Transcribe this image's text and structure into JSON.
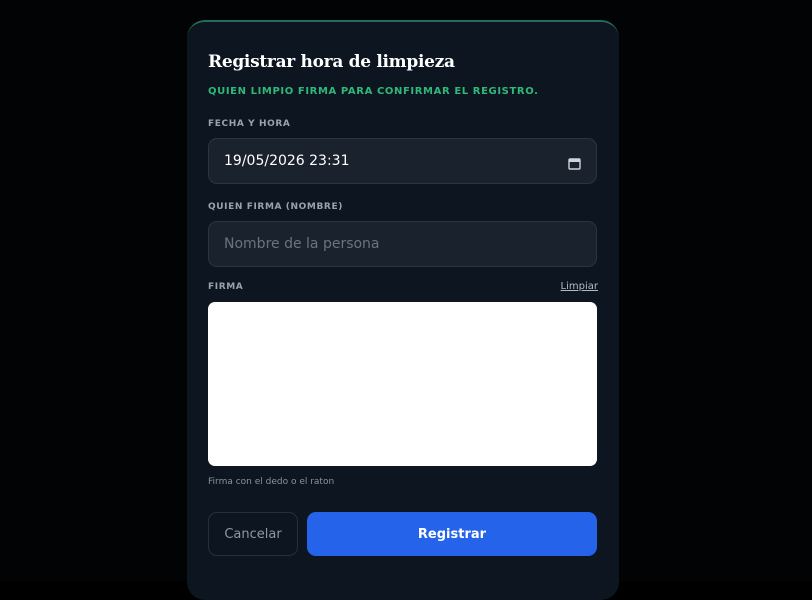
{
  "modal": {
    "title": "Registrar hora de limpieza",
    "subtitle": "QUIEN LIMPIO FIRMA PARA CONFIRMAR EL REGISTRO."
  },
  "datetime": {
    "label": "FECHA Y HORA",
    "value": "19/05/2026  23:31",
    "icon": "calendar-icon"
  },
  "signer": {
    "label": "QUIEN FIRMA (NOMBRE)",
    "placeholder": "Nombre de la persona",
    "value": ""
  },
  "signature": {
    "label": "FIRMA",
    "clear_label": "Limpiar",
    "hint": "Firma con el dedo o el raton"
  },
  "actions": {
    "cancel_label": "Cancelar",
    "submit_label": "Registrar"
  },
  "colors": {
    "accent_green": "#2fb87a",
    "primary_blue": "#2563eb",
    "modal_bg": "#0d1520",
    "field_bg": "#1a222d"
  }
}
